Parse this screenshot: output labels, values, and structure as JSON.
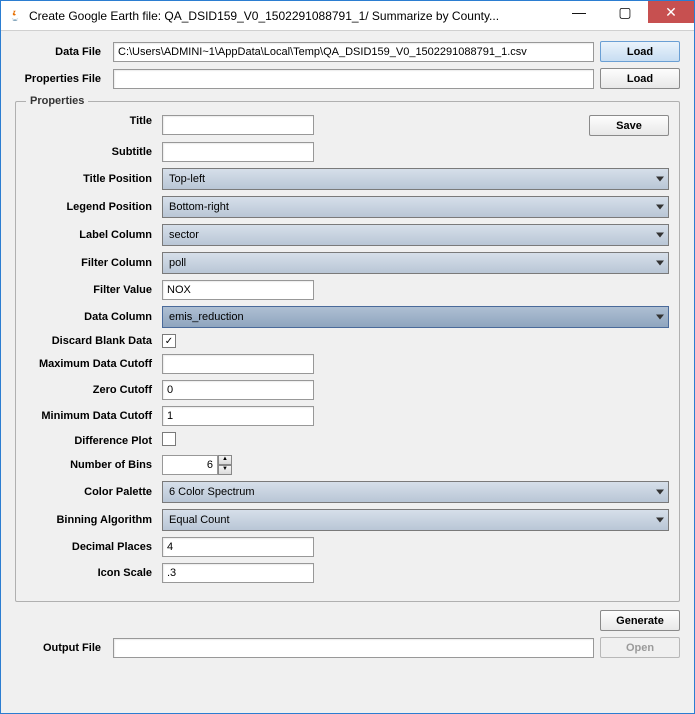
{
  "window": {
    "title": "Create Google Earth file: QA_DSID159_V0_1502291088791_1/ Summarize by County..."
  },
  "winControls": {
    "min": "—",
    "max": "▢",
    "close": "✕"
  },
  "top": {
    "dataFileLabel": "Data File",
    "dataFileValue": "C:\\Users\\ADMINI~1\\AppData\\Local\\Temp\\QA_DSID159_V0_1502291088791_1.csv",
    "loadLabel": "Load",
    "propsFileLabel": "Properties File",
    "propsFileValue": ""
  },
  "fieldset": {
    "legend": "Properties",
    "saveLabel": "Save"
  },
  "props": {
    "titleLabel": "Title",
    "titleValue": "",
    "subtitleLabel": "Subtitle",
    "subtitleValue": "",
    "titlePositionLabel": "Title Position",
    "titlePositionValue": "Top-left",
    "legendPositionLabel": "Legend Position",
    "legendPositionValue": "Bottom-right",
    "labelColLabel": "Label Column",
    "labelColValue": "sector",
    "filterColLabel": "Filter Column",
    "filterColValue": "poll",
    "filterValLabel": "Filter Value",
    "filterValValue": "NOX",
    "dataColLabel": "Data Column",
    "dataColValue": "emis_reduction",
    "discardBlankLabel": "Discard Blank Data",
    "discardBlankChecked": "✓",
    "maxCutoffLabel": "Maximum Data Cutoff",
    "maxCutoffValue": "",
    "zeroCutoffLabel": "Zero Cutoff",
    "zeroCutoffValue": "0",
    "minCutoffLabel": "Minimum Data Cutoff",
    "minCutoffValue": "1",
    "diffPlotLabel": "Difference Plot",
    "diffPlotChecked": "",
    "numBinsLabel": "Number of Bins",
    "numBinsValue": "6",
    "paletteLabel": "Color Palette",
    "paletteValue": "6 Color Spectrum",
    "binningLabel": "Binning Algorithm",
    "binningValue": "Equal Count",
    "decimalsLabel": "Decimal Places",
    "decimalsValue": "4",
    "iconScaleLabel": "Icon Scale",
    "iconScaleValue": ".3"
  },
  "bottom": {
    "generateLabel": "Generate",
    "outputLabel": "Output File",
    "outputValue": "",
    "openLabel": "Open"
  }
}
